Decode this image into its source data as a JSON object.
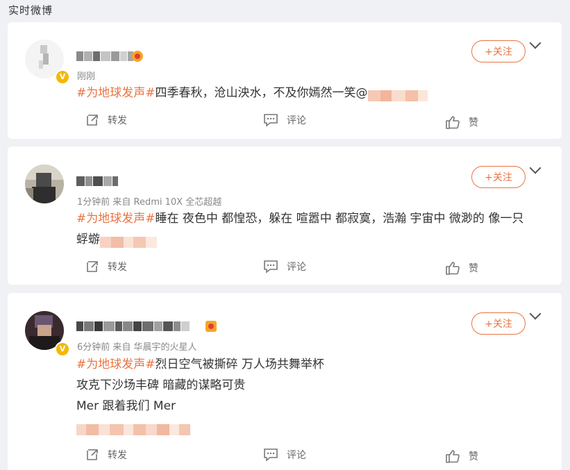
{
  "header": {
    "title": "实时微博"
  },
  "colors": {
    "accent": "#eb7340",
    "badge": "#f5b900",
    "background": "#f0f1f4"
  },
  "posts": [
    {
      "time": "刚刚",
      "topic": "#为地球发声#",
      "text": "四季春秋，沧山泱水，不及你嫣然一笑@",
      "follow_label": "+关注",
      "repost_label": "转发",
      "comment_label": "评论",
      "like_label": "赞"
    },
    {
      "time": "1分钟前  来自 Redmi 10X 全芯超越",
      "topic": "#为地球发声#",
      "text": "睡在 夜色中 都惶恐，躲在 喧嚣中 都寂寞，浩瀚 宇宙中 微渺的 像一只",
      "text2": "蜉蝣",
      "follow_label": "+关注",
      "repost_label": "转发",
      "comment_label": "评论",
      "like_label": "赞"
    },
    {
      "time": "6分钟前  来自 华晨宇的火星人",
      "topic": "#为地球发声#",
      "text": "烈日空气被撕碎 万人场共舞举杯",
      "line2": "攻克下沙场丰碑 暗藏的谋略可贵",
      "line3": "Mer 跟着我们 Mer",
      "follow_label": "+关注",
      "repost_label": "转发",
      "comment_label": "评论",
      "like_label": "赞"
    }
  ]
}
